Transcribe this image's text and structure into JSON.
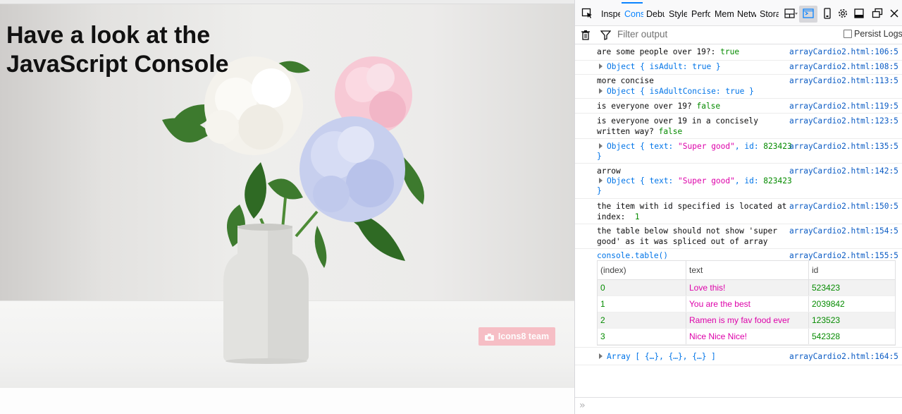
{
  "page": {
    "title_line1": "Have a look at the",
    "title_line2": "JavaScript Console",
    "photo_credit": "Icons8 team"
  },
  "devtools": {
    "tabs": [
      {
        "label": "Inspector"
      },
      {
        "label": "Console"
      },
      {
        "label": "Debugger"
      },
      {
        "label": "Style Editor"
      },
      {
        "label": "Performance"
      },
      {
        "label": "Memory"
      },
      {
        "label": "Network"
      },
      {
        "label": "Storage"
      }
    ],
    "filter_placeholder": "Filter output",
    "persist_logs": "Persist Logs",
    "accent_color": "#0a84ff"
  },
  "console": {
    "messages": [
      {
        "text": "are some people over 19?:",
        "value": "true",
        "source": "arrayCardio2.html:106:5"
      },
      {
        "object": "Object { isAdult: true }",
        "source": "arrayCardio2.html:108:5"
      },
      {
        "text": "more concise",
        "object": "Object { isAdultConcise: true }",
        "source": "arrayCardio2.html:113:5"
      },
      {
        "text": "is everyone over 19?",
        "value": "false",
        "source": "arrayCardio2.html:119:5"
      },
      {
        "text1": "is everyone over 19 in a concisely",
        "text2": "written way?",
        "value": "false",
        "source": "arrayCardio2.html:123:5"
      },
      {
        "object_prefix": "Object { text: ",
        "str": "\"Super good\"",
        "mid": ", id: ",
        "num": "823423",
        "close": "}",
        "source": "arrayCardio2.html:135:5"
      },
      {
        "text": "arrow",
        "object_prefix": "Object { text: ",
        "str": "\"Super good\"",
        "mid": ", id: ",
        "num": "823423",
        "close": "}",
        "source": "arrayCardio2.html:142:5"
      },
      {
        "text1": "the item with id specified is located at",
        "text2": "index:",
        "num": "1",
        "source": "arrayCardio2.html:150:5"
      },
      {
        "text1": "the table below should not show 'super",
        "text2": "good' as it was spliced out of array",
        "source": "arrayCardio2.html:154:5"
      },
      {
        "text": "console.table()",
        "source": "arrayCardio2.html:155:5"
      },
      {
        "object": "Array [ {…}, {…}, {…} ]",
        "source": "arrayCardio2.html:164:5"
      }
    ],
    "table": {
      "headers": [
        "(index)",
        "text",
        "id"
      ],
      "rows": [
        [
          "0",
          "Love this!",
          "523423"
        ],
        [
          "1",
          "You are the best",
          "2039842"
        ],
        [
          "2",
          "Ramen is my fav food ever",
          "123523"
        ],
        [
          "3",
          "Nice Nice Nice!",
          "542328"
        ]
      ]
    },
    "input_prompt": "»"
  }
}
